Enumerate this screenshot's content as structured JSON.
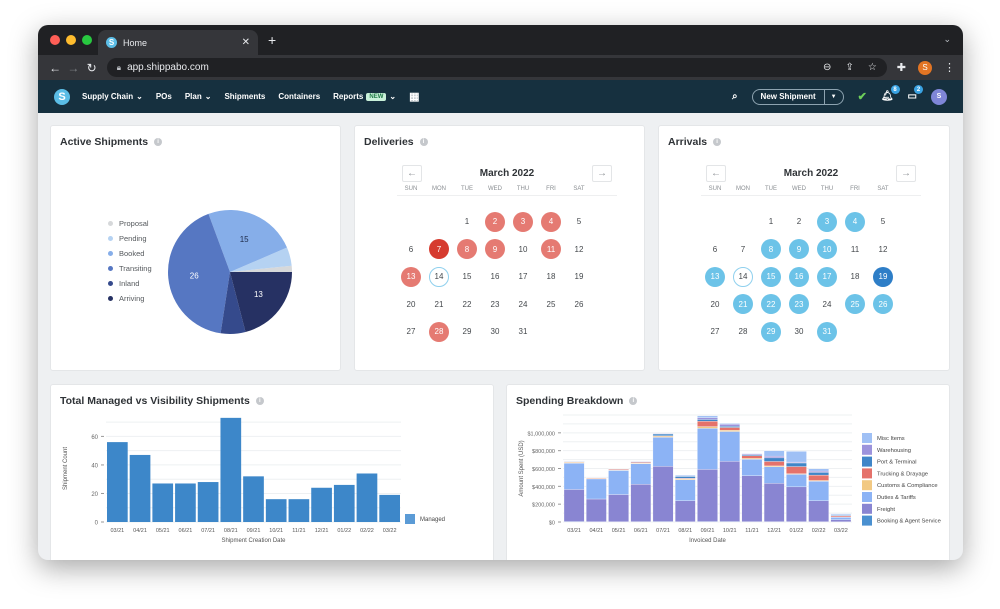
{
  "browser": {
    "tab_title": "Home",
    "tab_favicon_letter": "S",
    "new_tab": "+",
    "url": "app.shippabo.com",
    "profile_initial": "S"
  },
  "appnav": {
    "logo_letter": "S",
    "items": [
      {
        "label": "Supply Chain",
        "has_dropdown": true
      },
      {
        "label": "POs",
        "has_dropdown": false
      },
      {
        "label": "Plan",
        "has_dropdown": true
      },
      {
        "label": "Shipments",
        "has_dropdown": false
      },
      {
        "label": "Containers",
        "has_dropdown": false
      },
      {
        "label": "Reports",
        "has_dropdown": true,
        "badge": "NEW"
      }
    ],
    "new_shipment_label": "New Shipment",
    "notifications_count": "8",
    "messages_count": "2",
    "avatar_initial": "S"
  },
  "active_shipments": {
    "title": "Active Shipments",
    "chart_data": {
      "type": "pie",
      "title": "Active Shipments",
      "categories": [
        "Proposal",
        "Pending",
        "Booked",
        "Transiting",
        "Inland",
        "Arriving"
      ],
      "values": [
        1,
        3,
        15,
        26,
        4,
        13
      ],
      "data_labels": [
        "",
        "",
        "15",
        "26",
        "",
        "13"
      ],
      "colors": [
        "#d6d8da",
        "#b5d2f2",
        "#86aee9",
        "#5677c2",
        "#354a8c",
        "#263163"
      ],
      "legend": "left"
    }
  },
  "deliveries": {
    "title": "Deliveries",
    "month": "March 2022",
    "weekdays": [
      "SUN",
      "MON",
      "TUE",
      "WED",
      "THU",
      "FRI",
      "SAT"
    ],
    "start_offset": 2,
    "days_in_month": 31,
    "today": 14,
    "highlighted": [
      2,
      3,
      4,
      8,
      9,
      11,
      13,
      28
    ],
    "strong": [
      7
    ],
    "color": "#e57a72",
    "strong_color": "#d63b2f"
  },
  "arrivals": {
    "title": "Arrivals",
    "month": "March 2022",
    "weekdays": [
      "SUN",
      "MON",
      "TUE",
      "WED",
      "THU",
      "FRI",
      "SAT"
    ],
    "start_offset": 2,
    "days_in_month": 31,
    "today": 14,
    "highlighted": [
      3,
      4,
      8,
      9,
      10,
      13,
      15,
      16,
      17,
      21,
      22,
      23,
      25,
      26,
      29,
      31
    ],
    "strong": [
      19
    ],
    "color": "#6cc3e8",
    "strong_color": "#2e7ec7"
  },
  "managed_chart": {
    "title": "Total Managed vs Visibility Shipments",
    "chart_data": {
      "type": "bar",
      "title": "Total Managed vs Visibility Shipments",
      "categories": [
        "03/21",
        "04/21",
        "05/21",
        "06/21",
        "07/21",
        "08/21",
        "09/21",
        "10/21",
        "11/21",
        "12/21",
        "01/22",
        "02/22",
        "03/22"
      ],
      "series": [
        {
          "name": "Managed",
          "values": [
            56,
            47,
            27,
            27,
            28,
            73,
            32,
            16,
            16,
            24,
            26,
            34,
            19
          ],
          "color": "#3d87c9"
        }
      ],
      "xlabel": "Shipment Creation Date",
      "ylabel": "Shipment Count",
      "ylim": [
        0,
        75
      ],
      "yticks": [
        0,
        20,
        40,
        60
      ],
      "grid": true,
      "legend": "right"
    }
  },
  "spending_chart": {
    "title": "Spending Breakdown",
    "chart_data": {
      "type": "bar",
      "stacked": true,
      "title": "Spending Breakdown",
      "categories": [
        "03/21",
        "04/21",
        "05/21",
        "06/21",
        "07/21",
        "08/21",
        "09/21",
        "10/21",
        "11/21",
        "12/21",
        "01/22",
        "02/22",
        "03/22"
      ],
      "series": [
        {
          "name": "Booking & Agent Service",
          "color": "#4a90d0",
          "values": [
            5000,
            3000,
            3000,
            4000,
            5000,
            3000,
            5000,
            5000,
            4000,
            4000,
            4000,
            3000,
            2000
          ]
        },
        {
          "name": "Freight",
          "color": "#8985d2",
          "values": [
            360000,
            255000,
            305000,
            420000,
            620000,
            235000,
            585000,
            675000,
            515000,
            430000,
            390000,
            235000,
            25000
          ]
        },
        {
          "name": "Duties & Tariffs",
          "color": "#8cb3f5",
          "values": [
            295000,
            225000,
            270000,
            230000,
            325000,
            235000,
            460000,
            335000,
            185000,
            185000,
            140000,
            220000,
            25000
          ]
        },
        {
          "name": "Customs & Compliance",
          "color": "#f2c983",
          "values": [
            8000,
            6000,
            5000,
            7000,
            12000,
            10000,
            20000,
            15000,
            10000,
            10000,
            8000,
            8000,
            4000
          ]
        },
        {
          "name": "Trucking & Drayage",
          "color": "#e5726b",
          "values": [
            5000,
            8000,
            10000,
            8000,
            5000,
            8000,
            60000,
            30000,
            30000,
            50000,
            80000,
            60000,
            12000
          ]
        },
        {
          "name": "Port & Terminal",
          "color": "#4086c8",
          "values": [
            5000,
            2000,
            3000,
            5000,
            20000,
            20000,
            20000,
            15000,
            10000,
            40000,
            40000,
            30000,
            8000
          ]
        },
        {
          "name": "Warehousing",
          "color": "#9c93dc",
          "values": [
            3000,
            2000,
            2000,
            5000,
            5000,
            5000,
            20000,
            20000,
            10000,
            20000,
            10000,
            15000,
            5000
          ]
        },
        {
          "name": "Misc Items",
          "color": "#9fc0f5",
          "values": [
            0,
            0,
            0,
            0,
            0,
            10000,
            20000,
            10000,
            5000,
            60000,
            120000,
            25000,
            10000
          ]
        }
      ],
      "legend_order": [
        "Misc Items",
        "Warehousing",
        "Port & Terminal",
        "Trucking & Drayage",
        "Customs & Compliance",
        "Duties & Tariffs",
        "Freight",
        "Booking & Agent Service"
      ],
      "xlabel": "Invoiced Date",
      "ylabel": "Amount Spent (USD)",
      "ylim": [
        0,
        1200000
      ],
      "yticks": [
        0,
        200000,
        400000,
        600000,
        800000,
        1000000
      ],
      "ytick_labels": [
        "$0",
        "$200,000",
        "$400,000",
        "$600,000",
        "$800,000",
        "$1,000,000"
      ],
      "grid": true,
      "legend": "right"
    }
  }
}
